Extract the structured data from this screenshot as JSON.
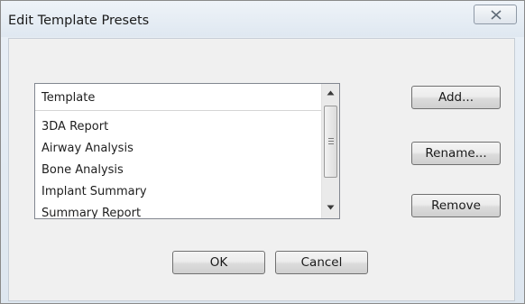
{
  "window": {
    "title": "Edit Template Presets",
    "close_icon": "close-x-icon"
  },
  "template_list": {
    "header": "Template",
    "items": [
      "3DA Report",
      "Airway Analysis",
      "Bone Analysis",
      "Implant Summary",
      "Summary Report"
    ],
    "scrollbar": {
      "up_icon": "scroll-up-arrow-icon",
      "down_icon": "scroll-down-arrow-icon"
    }
  },
  "buttons": {
    "add": "Add...",
    "rename": "Rename...",
    "remove": "Remove",
    "ok": "OK",
    "cancel": "Cancel"
  }
}
